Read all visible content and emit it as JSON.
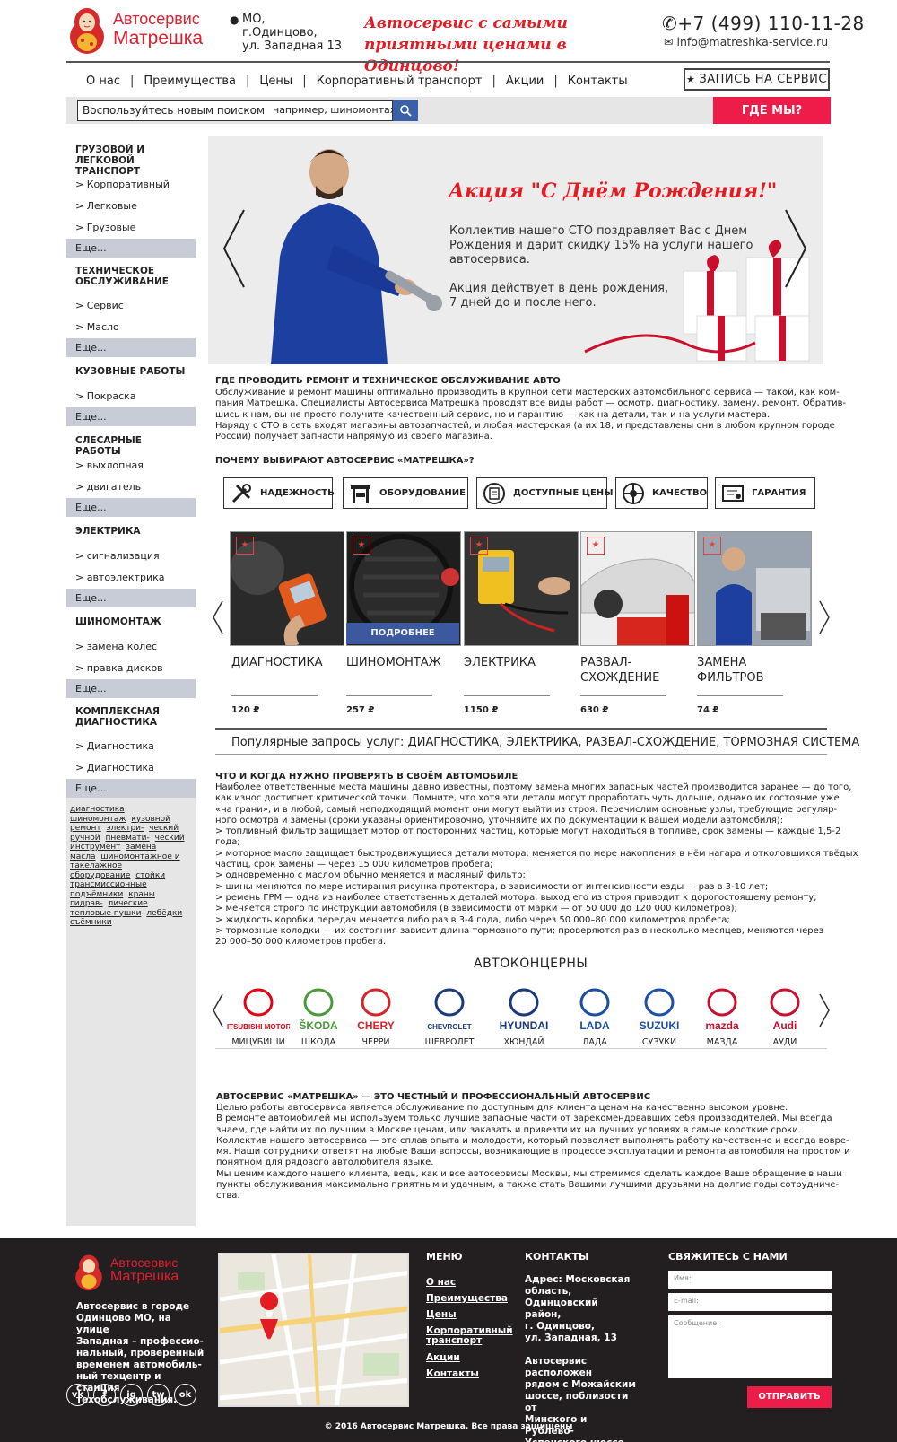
{
  "header": {
    "logo_line1": "Автосервис",
    "logo_line2": "Матрешка",
    "address_lines": [
      "МО,",
      "г.Одинцово,",
      "ул. Западная 13"
    ],
    "slogan_line1": "Автосервис с самыми",
    "slogan_line2": "приятными ценами в Одинцово!",
    "phone": "+7 (499) 110-11-28",
    "email": "info@matreshka-service.ru"
  },
  "nav": {
    "items": [
      "О нас",
      "Преимущества",
      "Цены",
      "Корпоративный транспорт",
      "Акции",
      "Контакты"
    ],
    "book_label": "ЗАПИСЬ НА СЕРВИС"
  },
  "search": {
    "label": "Воспользуйтесь новым поиском",
    "placeholder": "например, шиномонтаж",
    "where_label": "ГДЕ МЫ?"
  },
  "sidebar": {
    "groups": [
      {
        "title_lines": [
          "ГРУЗОВОЙ И ЛЕГКОВОЙ",
          "ТРАНСПОРТ"
        ],
        "items": [
          "> Корпоративный",
          "> Легковые",
          "> Грузовые"
        ],
        "more": "Еще..."
      },
      {
        "title_lines": [
          "ТЕХНИЧЕСКОЕ",
          "ОБСЛУЖИВАНИЕ"
        ],
        "items": [
          "> Сервис",
          "> Масло"
        ],
        "more": "Еще..."
      },
      {
        "title_lines": [
          "КУЗОВНЫЕ РАБОТЫ"
        ],
        "items": [
          "> Покраска"
        ],
        "more": "Еще..."
      },
      {
        "title_lines": [
          "СЛЕСАРНЫЕ РАБОТЫ"
        ],
        "items": [
          "> выхлопная",
          "> двигатель"
        ],
        "more": "Еще..."
      },
      {
        "title_lines": [
          "ЭЛЕКТРИКА"
        ],
        "items": [
          "> сигнализация",
          "> автоэлектрика"
        ],
        "more": "Еще..."
      },
      {
        "title_lines": [
          "ШИНОМОНТАЖ"
        ],
        "items": [
          "> замена колес",
          "> правка дисков"
        ],
        "more": "Еще..."
      },
      {
        "title_lines": [
          "КОМПЛЕКСНАЯ",
          "ДИАГНОСТИКА"
        ],
        "items": [
          "> Диагностика двигателя",
          "> Диагностика электрики"
        ],
        "more": "Еще..."
      }
    ],
    "tags": [
      "диагностика",
      "шиномонтаж",
      "кузовной ремонт",
      "электри-",
      "ческий ручной",
      "пневмати-",
      "ческий инструмент",
      "замена",
      "масла",
      "шиномонтажное и",
      "такелажное оборудование",
      "стойки трансмиссионные",
      "подъёмники",
      "краны гидрав-",
      "лические тепловые пушки",
      "лебёдки",
      "съёмники"
    ]
  },
  "banner": {
    "title": "Акция \"С Днём Рождения!\"",
    "text1_lines": [
      "Коллектив нашего СТО поздравляет Вас с Днем",
      "Рождения и дарит скидку 15% на услуги нашего",
      "автосервиса."
    ],
    "text2_lines": [
      "Акция действует в день рождения,",
      "7 дней до и после него."
    ]
  },
  "intro": {
    "heading": "ГДЕ ПРОВОДИТЬ РЕМОНТ И ТЕХНИЧЕСКОЕ ОБСЛУЖИВАНИЕ АВТО",
    "lines": [
      "Обслуживание и ремонт машины оптимально производить в крупной сети мастерских автомобильного сервиса — такой, как ком-",
      "пания Матрешка. Специалисты Автосервиса Матрешка проводят все виды работ — осмотр, диагностику, замену, ремонт. Обратив-",
      "шись к нам, вы не просто получите качественный сервис, но и гарантию — как на детали, так и на услуги мастера.",
      "Наряду с СТО в сеть входят магазины автозапчастей, и любая мастерская (а их 18, и представлены они в любом крупном городе",
      "России) получает запчасти напрямую из своего магазина."
    ]
  },
  "why": {
    "heading": "ПОЧЕМУ ВЫБИРАЮТ АВТОСЕРВИС «МАТРЕШКА»?",
    "benefits": [
      "НАДЕЖНОСТЬ",
      "ОБОРУДОВАНИЕ",
      "ДОСТУПНЫЕ ЦЕНЫ",
      "КАЧЕСТВО",
      "ГАРАНТИЯ"
    ]
  },
  "services": {
    "more_label": "ПОДРОБНЕЕ",
    "items": [
      {
        "name_lines": [
          "ДИАГНОСТИКА"
        ],
        "price": "120 ₽"
      },
      {
        "name_lines": [
          "ШИНОМОНТАЖ"
        ],
        "price": "257 ₽"
      },
      {
        "name_lines": [
          "ЭЛЕКТРИКА"
        ],
        "price": "1150 ₽"
      },
      {
        "name_lines": [
          "РАЗВАЛ-",
          "СХОЖДЕНИЕ"
        ],
        "price": "630 ₽"
      },
      {
        "name_lines": [
          "ЗАМЕНА",
          "ФИЛЬТРОВ"
        ],
        "price": "74 ₽"
      }
    ],
    "popular_label": "Популярные запросы услуг:",
    "popular_links": [
      "ДИАГНОСТИКА",
      "ЭЛЕКТРИКА",
      "РАЗВАЛ-СХОЖДЕНИЕ",
      "ТОРМОЗНАЯ СИСТЕМА"
    ]
  },
  "check": {
    "heading": "ЧТО И КОГДА НУЖНО ПРОВЕРЯТЬ В СВОЁМ АВТОМОБИЛЕ",
    "lines": [
      "Наиболее ответственные места машины давно известны, поэтому замена многих запасных частей производится заранее — до того,",
      "как износ достигнет критической   точки. Помните, что хотя эти детали могут проработать чуть дольше, однако их состояние уже",
      "«на грани», и в любой, самый неподходящий момент они могут выйти  из строя. Перечислим  основные узлы, требующие регуляр-",
      "ного осмотра и замены (сроки указаны ориентировочно, уточняйте их по документации к вашей модели   автомобиля):",
      "> топливный фильтр защищает мотор от посторонних частиц, которые могут находиться в топливе, срок замены — каждые 1,5-2",
      "года;",
      "> моторное масло защищает быстродвижущиеся детали мотора; меняется по мере накопления в нём нагара и отколовшихся твёдых",
      "частиц, срок замены — через   15 000 километров пробега;",
      "> одновременно с маслом обычно меняется и масляный фильтр;",
      "> шины меняются по мере истирания рисунка протектора, в зависимости от интенсивности езды — раз в 3-10 лет;",
      "> ремень ГРМ — одна из наиболее ответственных деталей мотора, выход его из строя приводит к дорогостоящему ремонту;",
      "> меняется строго по инструкции автомобиля (в зависимости от марки — от 50 000 до 120 000 километров);",
      "> жидкость коробки передач меняется либо раз в 3-4 года, либо через 50 000–80 000 километров пробега;",
      "> тормозные колодки — их состояния зависит длина тормозного пути; проверяются раз в несколько месяцев, меняются через",
      "20 000–50 000 километров пробега."
    ]
  },
  "brands": {
    "title": "АВТОКОНЦЕРНЫ",
    "items": [
      {
        "logo_text": "MITSUBISHI MOTORS",
        "name": "МИЦУБИШИ",
        "color": "#e60012"
      },
      {
        "logo_text": "ŠKODA",
        "name": "ШКОДА",
        "color": "#4a9a3a"
      },
      {
        "logo_text": "CHERY",
        "name": "ЧЕРРИ",
        "color": "#d8232a"
      },
      {
        "logo_text": "CHEVROLET",
        "name": "ШЕВРОЛЕТ",
        "color": "#1a3a7a"
      },
      {
        "logo_text": "HYUNDAI",
        "name": "ХЮНДАЙ",
        "color": "#1a3a7a"
      },
      {
        "logo_text": "LADA",
        "name": "ЛАДА",
        "color": "#1a4fa0"
      },
      {
        "logo_text": "SUZUKI",
        "name": "СУЗУКИ",
        "color": "#1f4fa8"
      },
      {
        "logo_text": "mazda",
        "name": "МАЗДА",
        "color": "#c8102e"
      },
      {
        "logo_text": "Audi",
        "name": "АУДИ",
        "color": "#c8102e"
      }
    ]
  },
  "about": {
    "heading": "АВТОСЕРВИС «МАТРЕШКА» — ЭТО ЧЕСТНЫЙ И ПРОФЕССИОНАЛЬНЫЙ АВТОСЕРВИС",
    "lines": [
      "Целью работы автосервиса является обслуживание по доступным для клиента ценам на качественно высоком уровне.",
      "В ремонте автомобилей мы используем только лучшие запасные части от зарекомендовавших себя производителей. Мы всегда",
      "знаем, где найти их по лучшим в Москве ценам, или заказать и привезти их на лучших условиях в самые короткие сроки.",
      "Коллектив нашего автосервиса — это сплав опыта и молодости, который позволяет выполнять работу качественно и всегда вовре-",
      "мя. Наши сотрудники ответят на любые Ваши вопросы, возникающие в процессе эксплуатации и ремонта автомобиля на простом и",
      "понятном для рядового автолюбителя языке.",
      "Мы ценим каждого нашего клиента, ведь, как и все автосервисы Москвы, мы стремимся сделать каждое Ваше обращение в наши",
      "пункты обслуживания максимально приятным и удачным, а также стать Вашими лучшими друзьями на долгие годы сотрудниче-",
      "ства."
    ]
  },
  "footer": {
    "logo_line1": "Автосервис",
    "logo_line2": "Матрешка",
    "about_lines": [
      "Автосервис в городе",
      "Одинцово МО, на улице",
      "Западная – професcио-",
      "нальный, проверенный",
      "временем автомобиль-",
      "ный техцентр и станция",
      "техобслуживания."
    ],
    "social": [
      "vk",
      "f",
      "ig",
      "tw",
      "ok"
    ],
    "menu_title": "МЕНЮ",
    "menu": [
      "О нас",
      "Преимущества",
      "Цены",
      "Корпоративный транспорт",
      "Акции",
      "Контакты"
    ],
    "contacts_title": "КОНТАКТЫ",
    "contacts_lines": [
      "Адрес: Московская",
      "область,",
      "Одинцовский район,",
      "г. Одинцово,",
      "ул. Западная, 13"
    ],
    "contacts_lines2": [
      "Автосервис расположен",
      "рядом с Можайским",
      "шоссе, поблизости от",
      "Минского и Рублево-",
      "Успенского шоссе."
    ],
    "form_title": "СВЯЖИТЕСЬ С НАМИ",
    "name_ph": "Имя:",
    "email_ph": "E-mail:",
    "msg_ph": "Сообщение:",
    "send_label": "ОТПРАВИТЬ",
    "copyright": "© 2016 Автосервис Матрешка. Все права защищены"
  },
  "colors": {
    "accent": "#e31b23",
    "button_red": "#ee1c48",
    "search_blue": "#3b5fa8",
    "footer_bg": "#231f20",
    "sidebar_bg": "#e6e6e6",
    "sidebar_more": "#c8ccd7"
  }
}
